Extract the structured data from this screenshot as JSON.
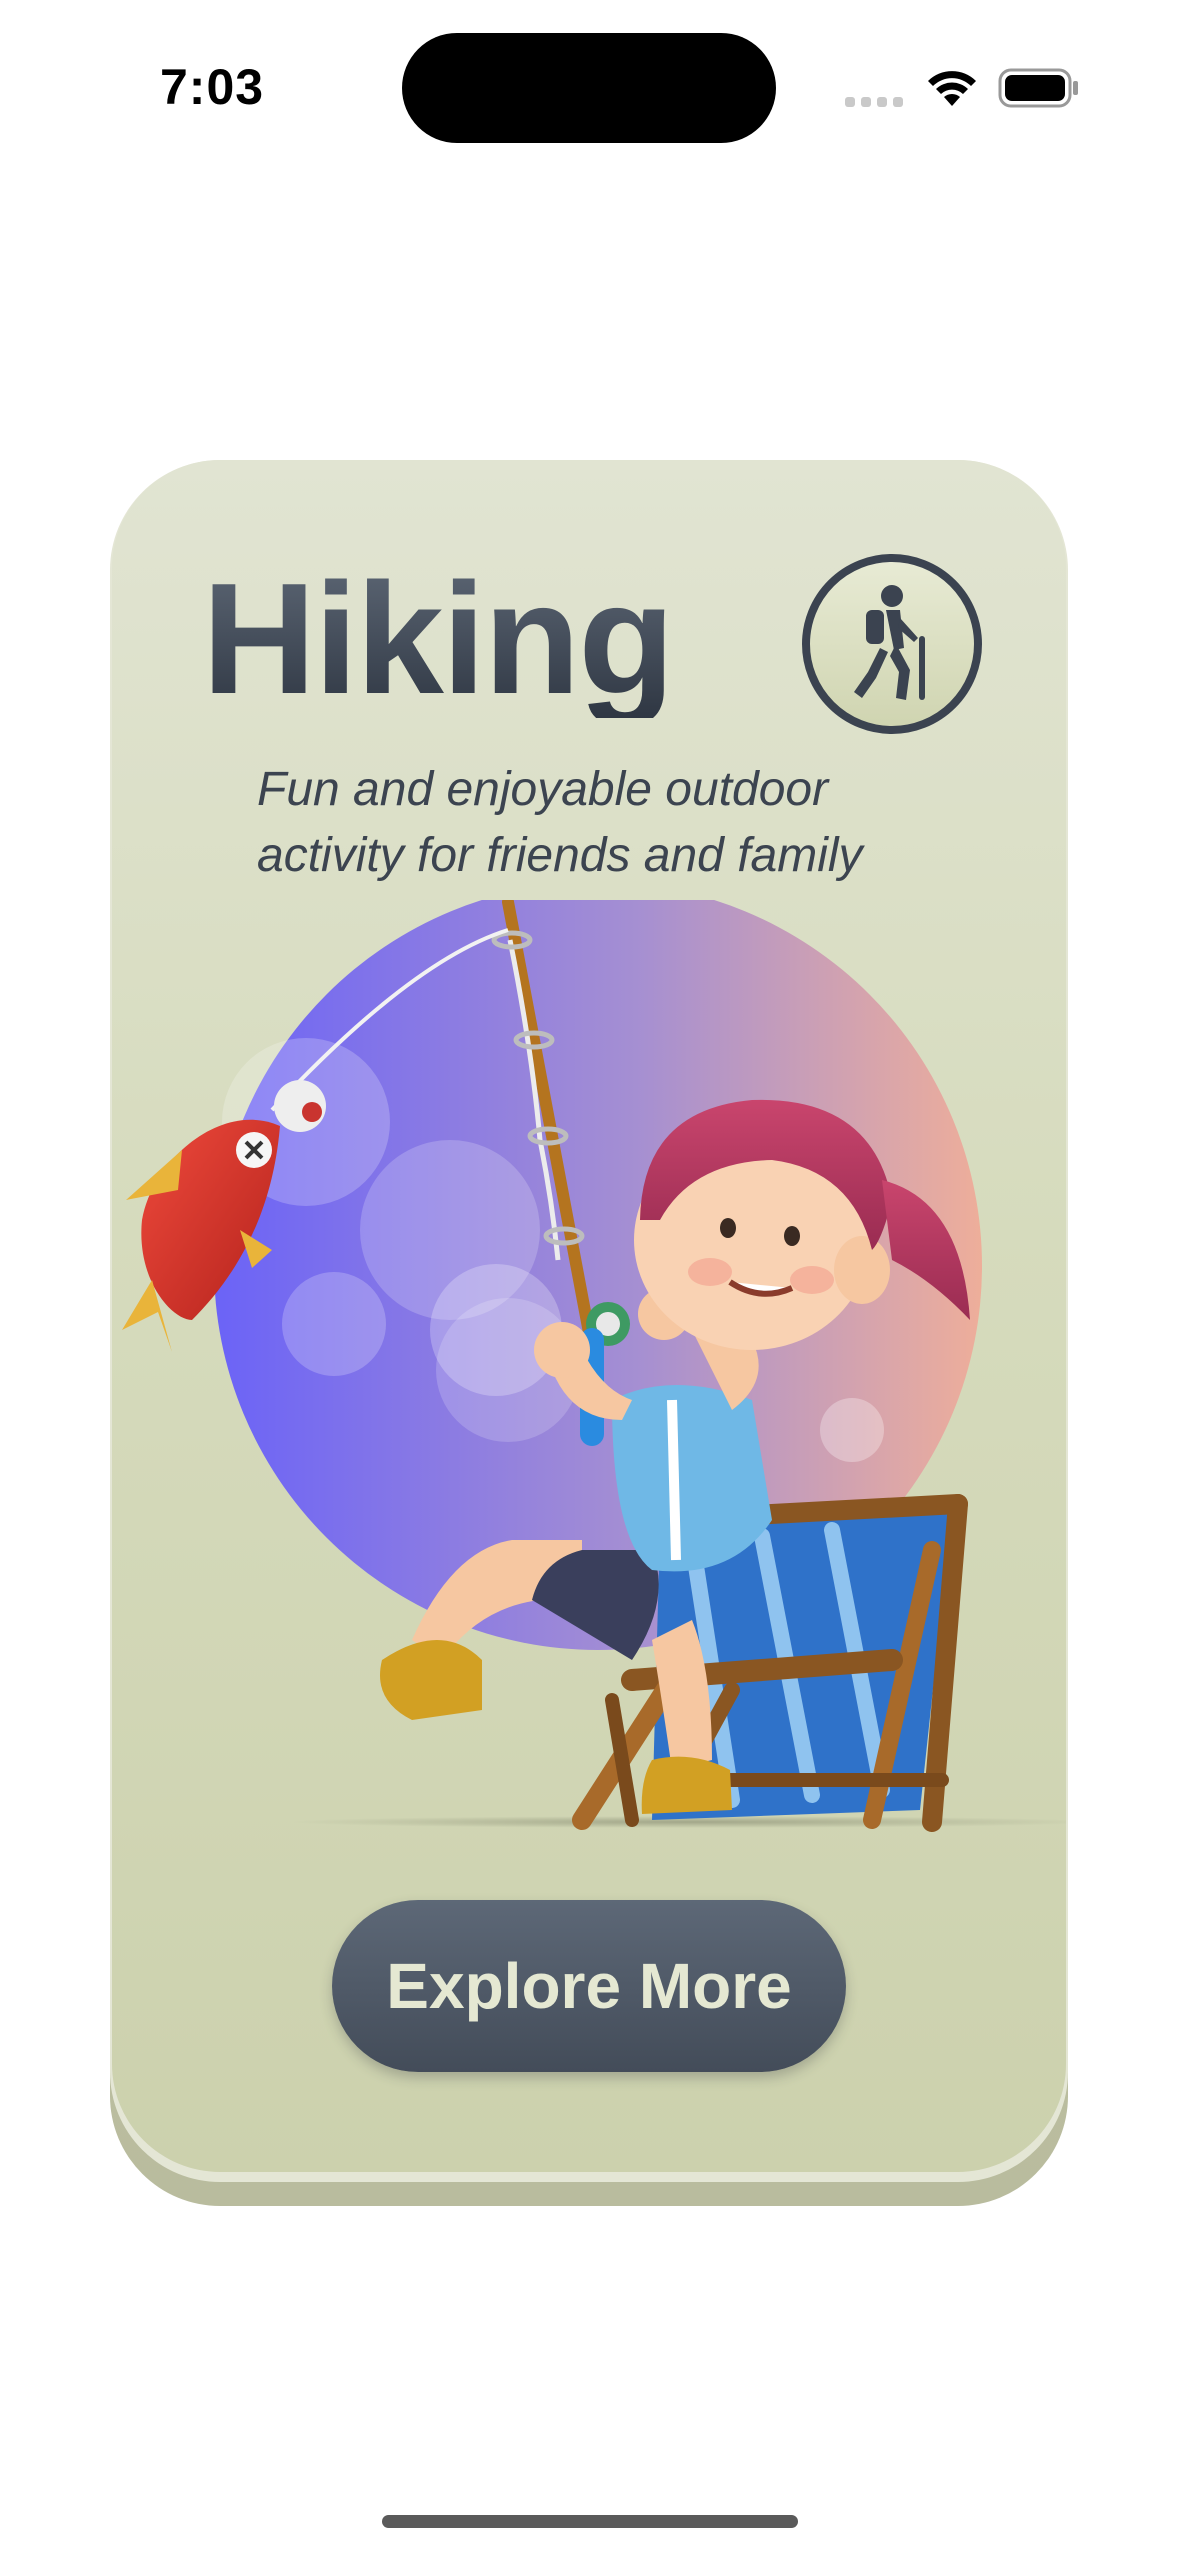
{
  "status_bar": {
    "time": "7:03",
    "icons": [
      "cellular-signal-icon",
      "wifi-icon",
      "battery-icon"
    ]
  },
  "card": {
    "title": "Hiking",
    "badge_icon": "hiker-icon",
    "subtitle": "Fun and enjoyable outdoor activity for friends and family",
    "illustration": "girl-fishing-on-deck-chair-illustration",
    "cta_label": "Explore More"
  },
  "colors": {
    "card_top": "#e1e4d2",
    "card_bottom": "#ccd1ad",
    "text_dark": "#3b4350",
    "button_bg": "#4f5866",
    "button_text": "#e5e8d2",
    "circle_left": "#6f66f5",
    "circle_right": "#e7aa9c"
  }
}
